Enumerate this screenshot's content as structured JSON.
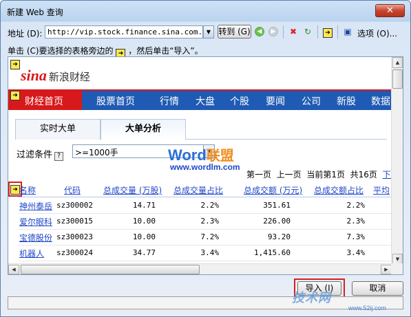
{
  "window": {
    "title": "新建 Web 查询",
    "close_glyph": "✕"
  },
  "toolbar": {
    "address_label": "地址 (D):",
    "address_value": "http://vip.stock.finance.sina.com.cn",
    "goto_label": "转到 (G)",
    "options_label": "选项 (O)..."
  },
  "instruction": {
    "before": "单击 (C)要选择的表格旁边的",
    "after": "，然后单击“导入”。"
  },
  "marker_glyph": "➜",
  "site": {
    "logo_mark": "sina",
    "logo_name": "新浪财经"
  },
  "nav": {
    "items": [
      "财经首页",
      "股票首页",
      "行情",
      "大盘",
      "个股",
      "要闻",
      "公司",
      "新股",
      "数据"
    ]
  },
  "tabs": [
    "实时大单",
    "大单分析"
  ],
  "filter": {
    "label": "过滤条件",
    "help": "?",
    "value": ">=1000手"
  },
  "watermark": {
    "word": "Word",
    "union": "联盟",
    "url": "www.wordlm.com"
  },
  "pager": {
    "first": "第一页",
    "prev": "上一页",
    "current": "当前第1页",
    "total": "共16页",
    "next": "下一"
  },
  "table": {
    "headers": [
      "名称",
      "代码",
      "总成交量 (万股)",
      "总成交量占比",
      "总成交额 (万元)",
      "总成交额占比",
      "平均"
    ],
    "rows": [
      {
        "name": "神州泰岳",
        "code": "sz300002",
        "vol": "14.71",
        "vol_pct": "2.2%",
        "amt": "351.61",
        "amt_pct": "2.2%"
      },
      {
        "name": "爱尔眼科",
        "code": "sz300015",
        "vol": "10.00",
        "vol_pct": "2.3%",
        "amt": "226.00",
        "amt_pct": "2.3%"
      },
      {
        "name": "宝德股份",
        "code": "sz300023",
        "vol": "10.00",
        "vol_pct": "7.2%",
        "amt": "93.20",
        "amt_pct": "7.3%"
      },
      {
        "name": "机器人",
        "code": "sz300024",
        "vol": "34.77",
        "vol_pct": "3.4%",
        "amt": "1,415.60",
        "amt_pct": "3.4%"
      }
    ]
  },
  "buttons": {
    "import": "导入 (I)",
    "cancel": "取消"
  },
  "branding": {
    "logo": "技术网",
    "url": "www.52ij.com"
  }
}
